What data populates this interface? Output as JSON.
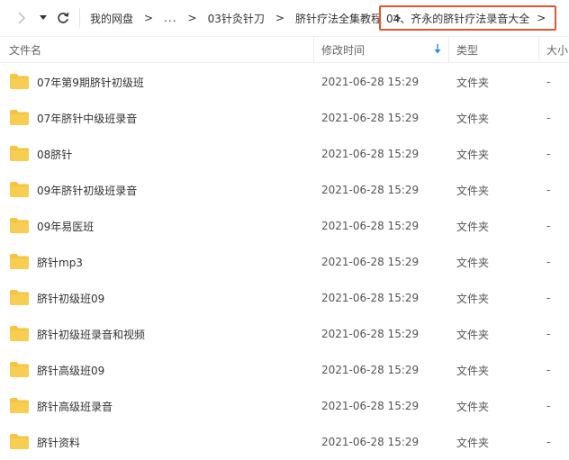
{
  "breadcrumb": {
    "items": [
      "我的网盘",
      "...",
      "03针灸针刀",
      "脐针疗法全集教程"
    ],
    "current": "04、齐永的脐针疗法录音大全",
    "separator": ">"
  },
  "columns": {
    "name": "文件名",
    "modified": "修改时间",
    "type": "类型",
    "size": "大小"
  },
  "colors": {
    "folder": "#f5c542",
    "highlight_border": "#e8542a",
    "sort_arrow": "#2b8be8"
  },
  "files": [
    {
      "name": "07年第9期脐针初级班",
      "modified": "2021-06-28 15:29",
      "type": "文件夹",
      "size": "-"
    },
    {
      "name": "07年脐针中级班录音",
      "modified": "2021-06-28 15:29",
      "type": "文件夹",
      "size": "-"
    },
    {
      "name": "08脐针",
      "modified": "2021-06-28 15:29",
      "type": "文件夹",
      "size": "-"
    },
    {
      "name": "09年脐针初级班录音",
      "modified": "2021-06-28 15:29",
      "type": "文件夹",
      "size": "-"
    },
    {
      "name": "09年易医班",
      "modified": "2021-06-28 15:29",
      "type": "文件夹",
      "size": "-"
    },
    {
      "name": "脐针mp3",
      "modified": "2021-06-28 15:29",
      "type": "文件夹",
      "size": "-"
    },
    {
      "name": "脐针初级班09",
      "modified": "2021-06-28 15:29",
      "type": "文件夹",
      "size": "-"
    },
    {
      "name": "脐针初级班录音和视频",
      "modified": "2021-06-28 15:29",
      "type": "文件夹",
      "size": "-"
    },
    {
      "name": "脐针高级班09",
      "modified": "2021-06-28 15:29",
      "type": "文件夹",
      "size": "-"
    },
    {
      "name": "脐针高级班录音",
      "modified": "2021-06-28 15:29",
      "type": "文件夹",
      "size": "-"
    },
    {
      "name": "脐针资料",
      "modified": "2021-06-28 15:29",
      "type": "文件夹",
      "size": "-"
    }
  ]
}
